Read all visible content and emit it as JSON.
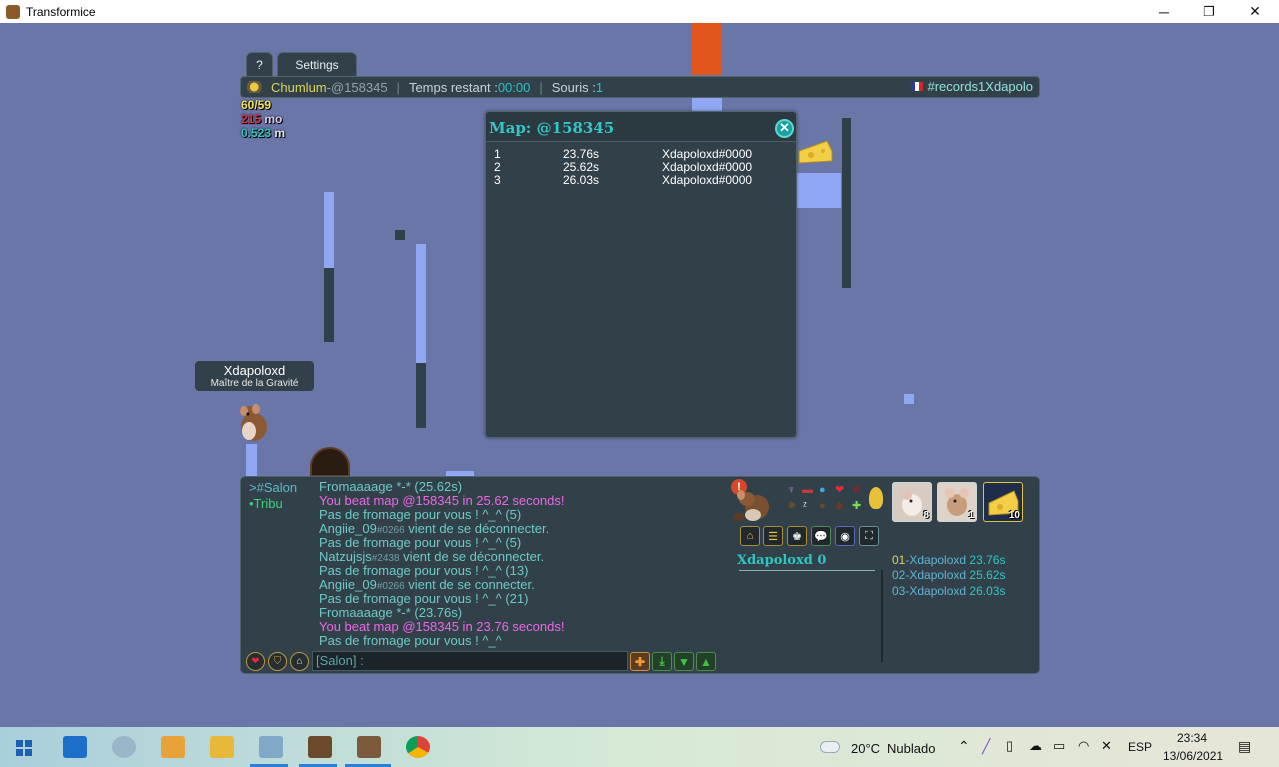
{
  "window": {
    "title": "Transformice",
    "controls": {
      "minimize": "─",
      "maximize": "❐",
      "close": "✕"
    }
  },
  "tabs": {
    "help": "?",
    "settings": "Settings"
  },
  "topbar": {
    "player": "Chumlum",
    "dash": " - ",
    "map_code": "@158345",
    "time_label": "Temps restant : ",
    "time_value": "00:00",
    "mice_label": "Souris : ",
    "mice_value": "1",
    "room": "#records1Xdapolo"
  },
  "stats": {
    "cheese": "60/59",
    "money_value": "215",
    "money_unit": " mo",
    "distance_value": "0.523",
    "distance_unit": " m"
  },
  "nametag": {
    "name": "Xdapoloxd",
    "title": "Maître de la Gravité"
  },
  "map_window": {
    "title": "Map: @158345",
    "close": "✕",
    "records": [
      {
        "rank": "1",
        "time": "23.76s",
        "player": "Xdapoloxd#0000"
      },
      {
        "rank": "2",
        "time": "25.62s",
        "player": "Xdapoloxd#0000"
      },
      {
        "rank": "3",
        "time": "26.03s",
        "player": "Xdapoloxd#0000"
      }
    ]
  },
  "chat": {
    "channels": {
      "salon": ">#Salon",
      "tribu": "•Tribu"
    },
    "messages": [
      {
        "text": "Fromaaaage *-* (25.62s)",
        "tag": "",
        "rest": "",
        "style": "cyan"
      },
      {
        "text": "You beat map @158345 in 25.62 seconds!",
        "tag": "",
        "rest": "",
        "style": "pink"
      },
      {
        "text": "Pas de fromage pour vous ! ^_^ (5)",
        "tag": "",
        "rest": "",
        "style": "cyan"
      },
      {
        "text": "Angiie_09",
        "tag": "#0266",
        "rest": " vient de se déconnecter.",
        "style": "cyan"
      },
      {
        "text": "Pas de fromage pour vous ! ^_^ (5)",
        "tag": "",
        "rest": "",
        "style": "cyan"
      },
      {
        "text": "Natzujsjs",
        "tag": "#2438",
        "rest": " vient de se déconnecter.",
        "style": "cyan"
      },
      {
        "text": "Pas de fromage pour vous ! ^_^ (13)",
        "tag": "",
        "rest": "",
        "style": "cyan"
      },
      {
        "text": "Angiie_09",
        "tag": "#0266",
        "rest": " vient de se connecter.",
        "style": "cyan"
      },
      {
        "text": "Pas de fromage pour vous ! ^_^ (21)",
        "tag": "",
        "rest": "",
        "style": "cyan"
      },
      {
        "text": "Fromaaaage *-* (23.76s)",
        "tag": "",
        "rest": "",
        "style": "cyan"
      },
      {
        "text": "You beat map @158345 in 23.76 seconds!",
        "tag": "",
        "rest": "",
        "style": "pink"
      },
      {
        "text": "Pas de fromage pour vous ! ^_^",
        "tag": "",
        "rest": "",
        "style": "cyan"
      }
    ],
    "input_placeholder": "[Salon] :"
  },
  "player_panel": {
    "name": "Xdapoloxd 0",
    "avatar_counts": [
      "8",
      "1",
      "10"
    ],
    "ranking": [
      {
        "num": "01",
        "name": "-Xdapoloxd",
        "time": " 23.76s"
      },
      {
        "num": "02",
        "name": "-Xdapoloxd",
        "time": " 25.62s"
      },
      {
        "num": "03",
        "name": "-Xdapoloxd",
        "time": " 26.03s"
      }
    ]
  },
  "taskbar": {
    "weather_temp": "20°C",
    "weather_desc": "Nublado",
    "language": "ESP",
    "time": "23:34",
    "date": "13/06/2021"
  },
  "colors": {
    "game_bg": "#6a75a8",
    "panel_bg": "#324149",
    "accent_cyan": "#27c3c8",
    "chat_pink": "#ec67e6",
    "highlight_yellow": "#dcd65b",
    "platform_light": "#90a8f4",
    "platform_dark": "#2f4048",
    "lava": "#e0561c"
  }
}
